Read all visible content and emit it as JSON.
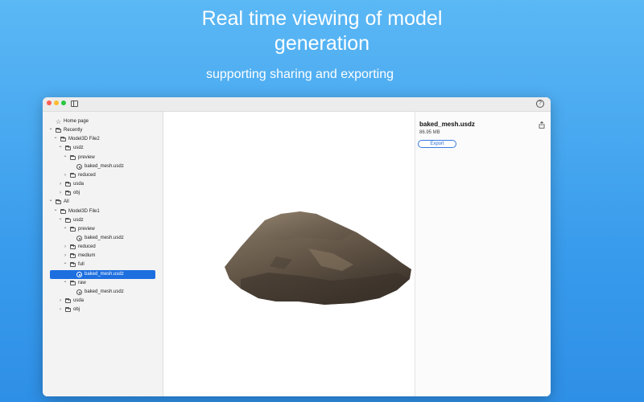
{
  "headline": {
    "line1": "Real time viewing of model",
    "line2": "generation",
    "subtitle": "supporting sharing and exporting"
  },
  "sidebar": {
    "rows": [
      {
        "label": "Home page",
        "icon": "star-icon",
        "indent": 0,
        "chevron": "none"
      },
      {
        "label": "Recently",
        "icon": "folder-icon",
        "indent": 0,
        "chevron": "down"
      },
      {
        "label": "Model3D File2",
        "icon": "folder-icon",
        "indent": 1,
        "chevron": "down"
      },
      {
        "label": "usdz",
        "icon": "folder-icon",
        "indent": 2,
        "chevron": "down"
      },
      {
        "label": "preview",
        "icon": "folder-icon",
        "indent": 3,
        "chevron": "down"
      },
      {
        "label": "baked_mesh.usdz",
        "icon": "file-icon",
        "indent": 4,
        "chevron": "none"
      },
      {
        "label": "reduced",
        "icon": "folder-icon",
        "indent": 3,
        "chevron": "right"
      },
      {
        "label": "usda",
        "icon": "folder-icon",
        "indent": 2,
        "chevron": "right"
      },
      {
        "label": "obj",
        "icon": "folder-icon",
        "indent": 2,
        "chevron": "right"
      },
      {
        "label": "All",
        "icon": "folder-icon",
        "indent": 0,
        "chevron": "down"
      },
      {
        "label": "Model3D File1",
        "icon": "folder-icon",
        "indent": 1,
        "chevron": "down"
      },
      {
        "label": "usdz",
        "icon": "folder-icon",
        "indent": 2,
        "chevron": "down"
      },
      {
        "label": "preview",
        "icon": "folder-icon",
        "indent": 3,
        "chevron": "down"
      },
      {
        "label": "baked_mesh.usdz",
        "icon": "file-icon",
        "indent": 4,
        "chevron": "none"
      },
      {
        "label": "reduced",
        "icon": "folder-icon",
        "indent": 3,
        "chevron": "right"
      },
      {
        "label": "medium",
        "icon": "folder-icon",
        "indent": 3,
        "chevron": "right"
      },
      {
        "label": "full",
        "icon": "folder-icon",
        "indent": 3,
        "chevron": "down"
      },
      {
        "label": "baked_mesh.usdz",
        "icon": "file-icon",
        "indent": 4,
        "chevron": "none",
        "selected": true
      },
      {
        "label": "raw",
        "icon": "folder-icon",
        "indent": 3,
        "chevron": "down"
      },
      {
        "label": "baked_mesh.usdz",
        "icon": "file-icon",
        "indent": 4,
        "chevron": "none"
      },
      {
        "label": "usda",
        "icon": "folder-icon",
        "indent": 2,
        "chevron": "right"
      },
      {
        "label": "obj",
        "icon": "folder-icon",
        "indent": 2,
        "chevron": "right"
      }
    ]
  },
  "inspector": {
    "file_name": "baked_mesh.usdz",
    "file_size": "86.95 MB",
    "export_label": "Export"
  },
  "colors": {
    "selection": "#1d6fe0",
    "accent": "#2a6fd6",
    "rock": "#6b5d4d"
  }
}
